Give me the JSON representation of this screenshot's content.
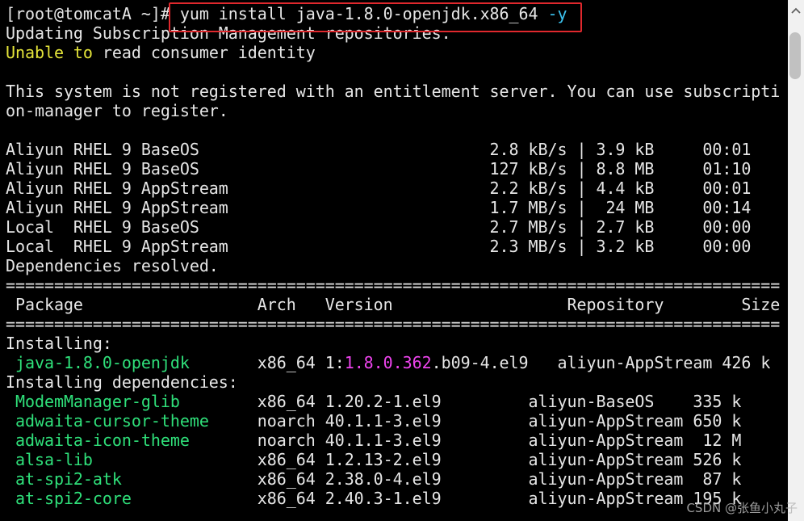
{
  "terminal": {
    "prompt": "[root@tomcatA ~]# ",
    "command": "yum install java-1.8.0-openjdk.x86_64 ",
    "command_flag": "-y",
    "output": {
      "line1": "Updating Subscription Management repositories.",
      "line2a": "Unable to",
      "line2b": " read consumer identity",
      "line3": "This system is not registered with an entitlement server. You can use subscripti",
      "line4": "on-manager to register."
    },
    "repos": [
      {
        "text": "Aliyun RHEL 9 BaseOS                              2.8 kB/s | 3.9 kB     00:01"
      },
      {
        "text": "Aliyun RHEL 9 BaseOS                              127 kB/s | 8.8 MB     01:10"
      },
      {
        "text": "Aliyun RHEL 9 AppStream                           2.2 kB/s | 4.4 kB     00:01"
      },
      {
        "text": "Aliyun RHEL 9 AppStream                           1.7 MB/s |  24 MB     00:14"
      },
      {
        "text": "Local  RHEL 9 BaseOS                              2.7 MB/s | 2.7 kB     00:00"
      },
      {
        "text": "Local  RHEL 9 AppStream                           2.3 MB/s | 3.2 kB     00:00"
      }
    ],
    "deps_resolved": "Dependencies resolved.",
    "separator": "================================================================================",
    "table_header": " Package                  Arch   Version                  Repository        Size",
    "installing_label": "Installing:",
    "main_package": {
      "name": " java-1.8.0-openjdk",
      "arch_pad": "       x86_64 1:",
      "version_highlight": "1.8.0.362",
      "version_rest": ".b09-4.el9   aliyun-AppStream 426 k"
    },
    "installing_deps_label": "Installing dependencies:",
    "dependencies": [
      {
        "name": " ModemManager-glib",
        "rest": "        x86_64 1.20.2-1.el9         aliyun-BaseOS    335 k"
      },
      {
        "name": " adwaita-cursor-theme",
        "rest": "     noarch 40.1.1-3.el9         aliyun-AppStream 650 k"
      },
      {
        "name": " adwaita-icon-theme",
        "rest": "       noarch 40.1.1-3.el9         aliyun-AppStream  12 M"
      },
      {
        "name": " alsa-lib",
        "rest": "                 x86_64 1.2.13-2.el9         aliyun-AppStream 526 k"
      },
      {
        "name": " at-spi2-atk",
        "rest": "              x86_64 2.38.0-4.el9         aliyun-AppStream  87 k"
      },
      {
        "name": " at-spi2-core",
        "rest": "             x86_64 2.40.3-1.el9         aliyun-AppStream 195 k"
      }
    ]
  },
  "watermark": "CSDN @张鱼小丸子",
  "colors": {
    "background": "#000000",
    "text": "#e6e6e6",
    "package_green": "#2fe07a",
    "warning_yellow": "#e5e53a",
    "version_magenta": "#ee44ee",
    "flag_cyan": "#3cc3f0",
    "highlight_red": "#e0282d"
  }
}
